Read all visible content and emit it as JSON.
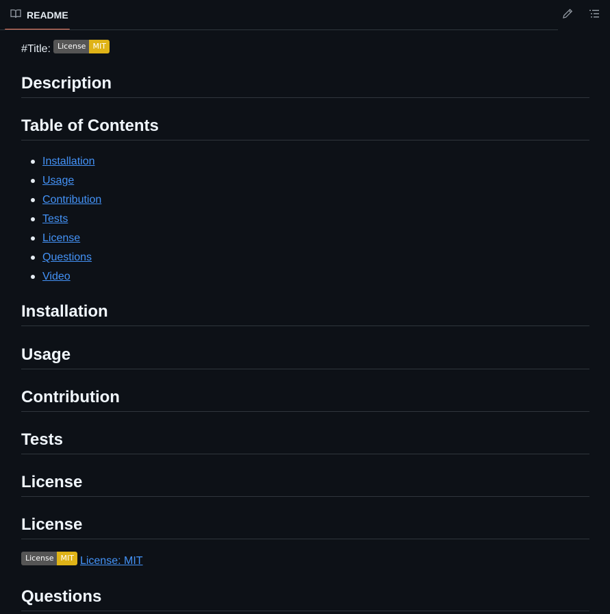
{
  "header": {
    "tab_label": "README",
    "tab_icon": "book-icon",
    "edit_icon": "pencil-icon",
    "outline_icon": "list-icon",
    "accent": "#f78166"
  },
  "readme": {
    "title_prefix": "#Title:",
    "badge": {
      "left": "License",
      "right": "MIT",
      "right_color": "#dfb317"
    },
    "headings": {
      "description": "Description",
      "toc": "Table of Contents",
      "installation": "Installation",
      "usage": "Usage",
      "contribution": "Contribution",
      "tests": "Tests",
      "license1": "License",
      "license2": "License",
      "questions": "Questions"
    },
    "toc_items": [
      "Installation",
      "Usage",
      "Contribution",
      "Tests",
      "License",
      "Questions",
      "Video"
    ],
    "license_link": "License: MIT"
  }
}
